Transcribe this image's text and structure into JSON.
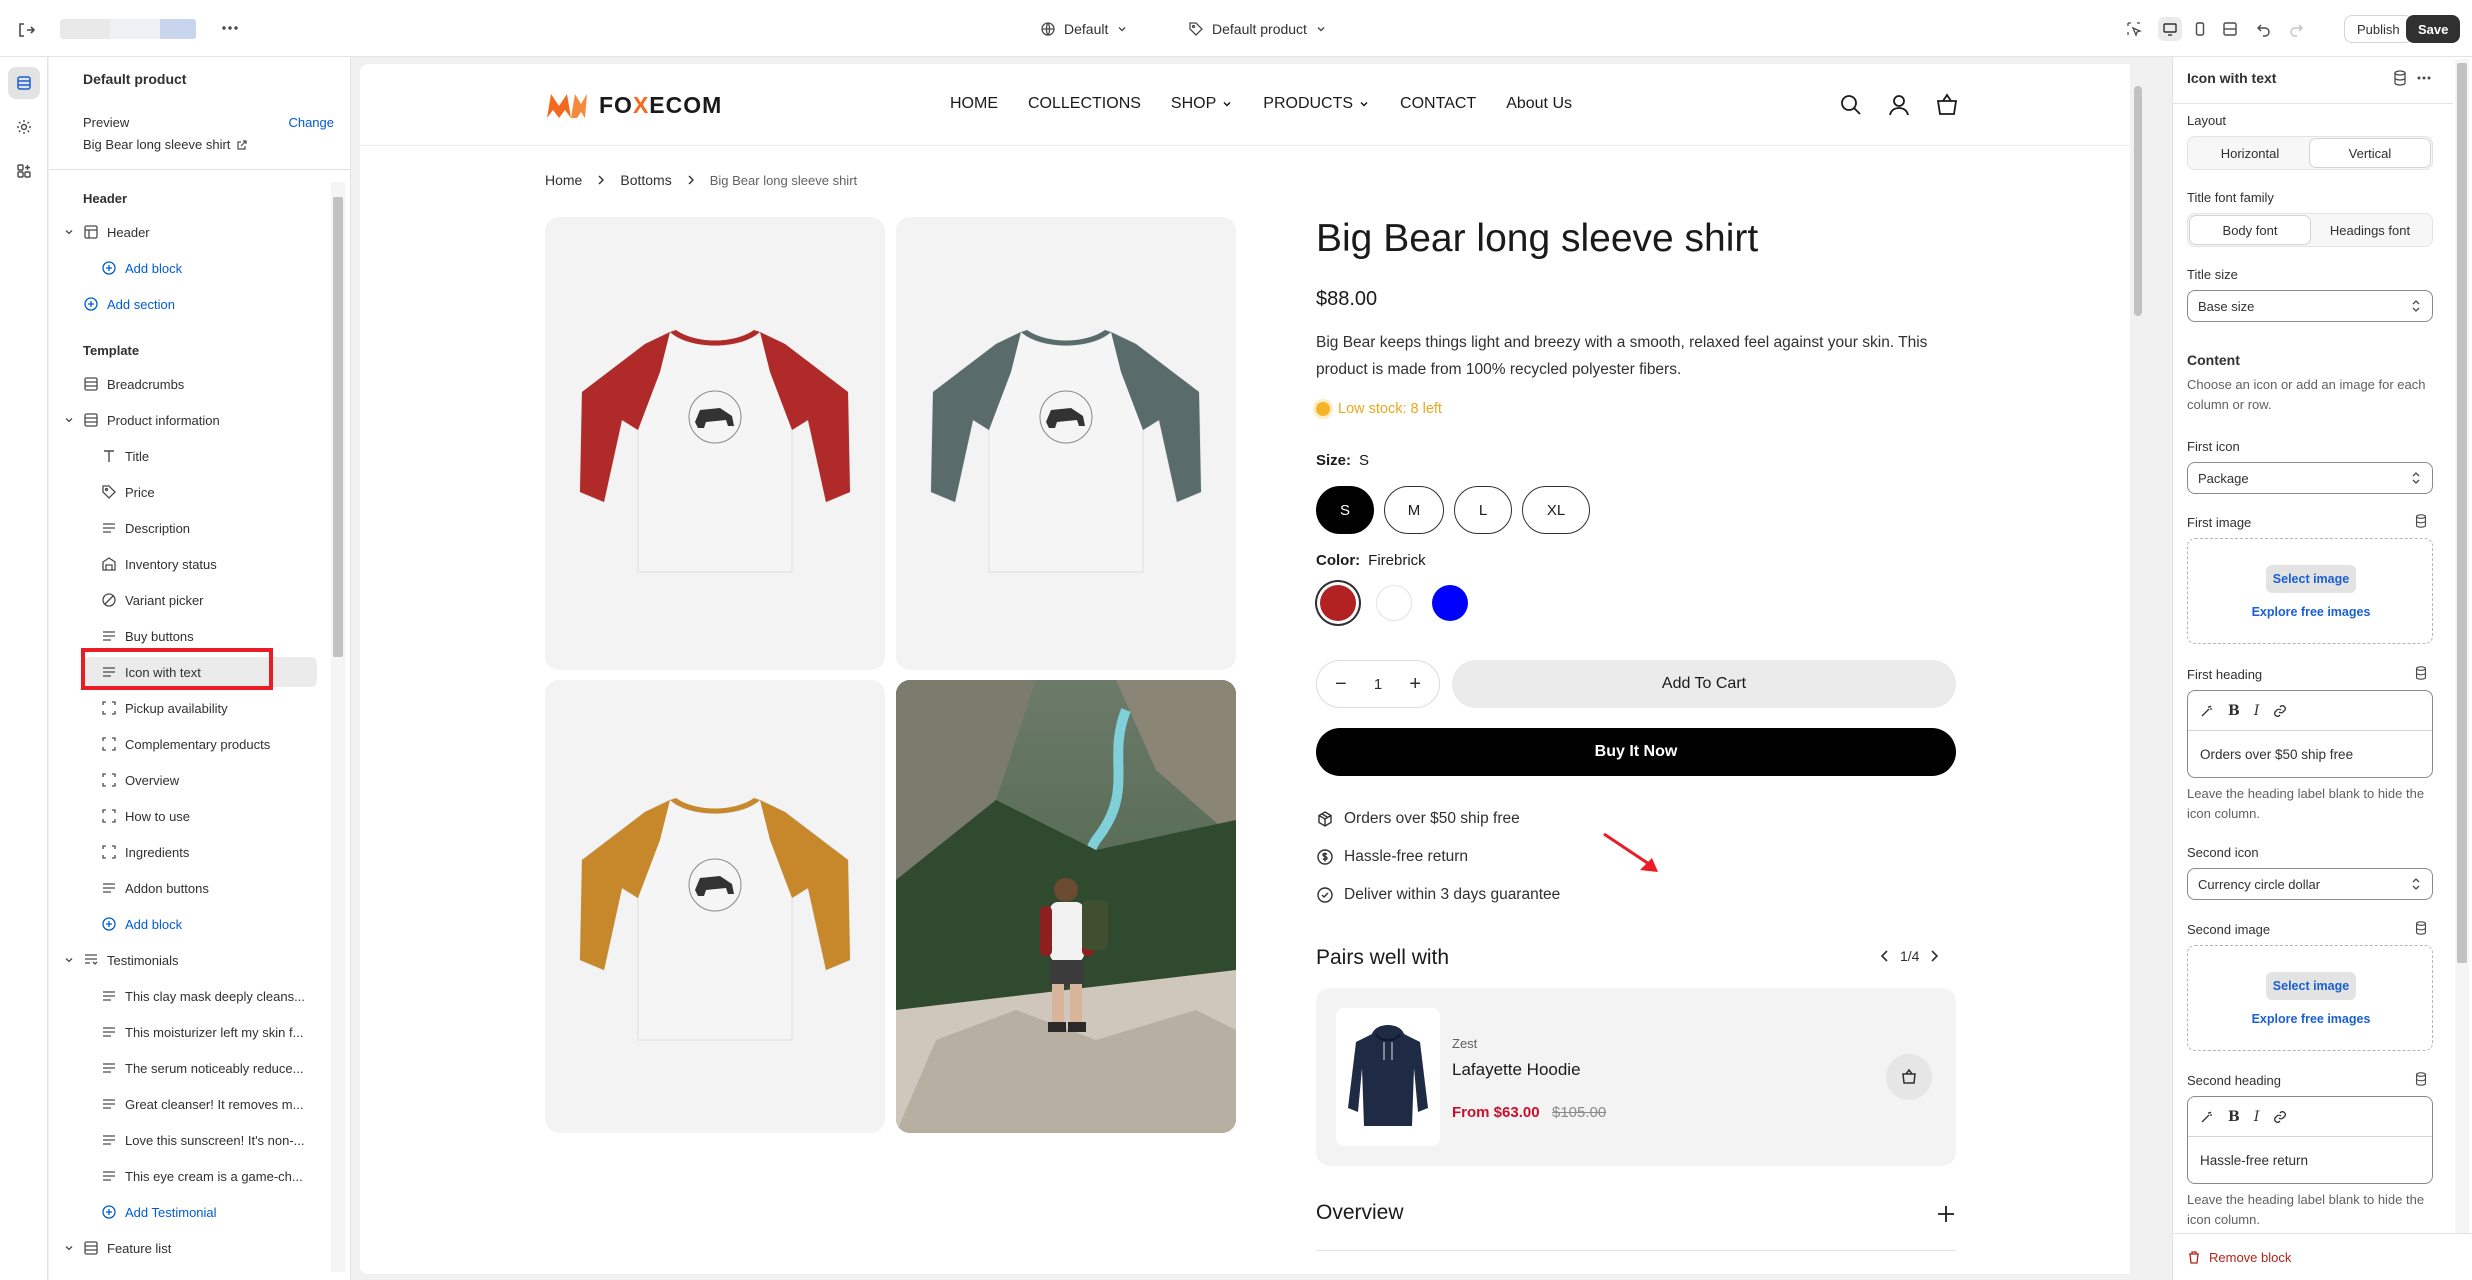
{
  "topbar": {
    "theme_label": "Default",
    "template_label": "Default product",
    "publish_label": "Publish",
    "save_label": "Save"
  },
  "left_panel": {
    "title": "Default product",
    "preview_label": "Preview",
    "change_label": "Change",
    "preview_value": "Big Bear long sleeve shirt",
    "header_section": "Header",
    "header_item": "Header",
    "add_block": "Add block",
    "add_section": "Add section",
    "template_section": "Template",
    "breadcrumbs": "Breadcrumbs",
    "product_information": "Product information",
    "blocks": [
      "Title",
      "Price",
      "Description",
      "Inventory status",
      "Variant picker",
      "Buy buttons",
      "Icon with text",
      "Pickup availability",
      "Complementary products",
      "Overview",
      "How to use",
      "Ingredients",
      "Addon buttons"
    ],
    "add_block_2": "Add block",
    "testimonials": "Testimonials",
    "testimonial_items": [
      "This clay mask deeply cleans...",
      "This moisturizer left my skin f...",
      "The serum noticeably reduce...",
      "Great cleanser! It removes m...",
      "Love this sunscreen! It's non-...",
      "This eye cream is a game-ch..."
    ],
    "add_testimonial": "Add Testimonial",
    "feature_list": "Feature list"
  },
  "store": {
    "logo": "FOXECOM",
    "nav": [
      "HOME",
      "COLLECTIONS",
      "SHOP",
      "PRODUCTS",
      "CONTACT",
      "About Us"
    ],
    "breadcrumb": [
      "Home",
      "Bottoms",
      "Big Bear long sleeve shirt"
    ],
    "tile_colors": [
      "#b02a2a",
      "#5a6b6b",
      "#c6882a"
    ],
    "product": {
      "title": "Big Bear long sleeve shirt",
      "price": "$88.00",
      "description": "Big Bear keeps things light and breezy with a smooth, relaxed feel against your skin. This product is made from 100% recycled polyester fibers.",
      "stock": "Low stock: 8 left",
      "size_label": "Size:",
      "size_value": "S",
      "sizes": [
        "S",
        "M",
        "L",
        "XL"
      ],
      "color_label": "Color:",
      "color_value": "Firebrick",
      "swatches": [
        "#b22222",
        "#ffffff",
        "#0000ff"
      ],
      "qty": "1",
      "add_to_cart": "Add To Cart",
      "buy_now": "Buy It Now"
    },
    "icon_with_text": [
      {
        "icon": "package-icon",
        "text": "Orders over $50 ship free"
      },
      {
        "icon": "currency-circle-dollar-icon",
        "text": "Hassle-free return"
      },
      {
        "icon": "check-circle-icon",
        "text": "Deliver within 3 days guarantee"
      }
    ],
    "pairs": {
      "title": "Pairs well with",
      "pager": "1/4",
      "vendor": "Zest",
      "name": "Lafayette Hoodie",
      "price": "From $63.00",
      "compare": "$105.00"
    },
    "overview": "Overview"
  },
  "right_panel": {
    "title": "Icon with text",
    "layout_label": "Layout",
    "layout_options": [
      "Horizontal",
      "Vertical"
    ],
    "title_font_label": "Title font family",
    "title_font_options": [
      "Body font",
      "Headings font"
    ],
    "title_size_label": "Title size",
    "title_size_value": "Base size",
    "content_label": "Content",
    "content_help": "Choose an icon or add an image for each column or row.",
    "first_icon_label": "First icon",
    "first_icon_value": "Package",
    "first_image_label": "First image",
    "select_image": "Select image",
    "explore_images": "Explore free images",
    "first_heading_label": "First heading",
    "first_heading_value": "Orders over $50 ship free",
    "heading_help": "Leave the heading label blank to hide the icon column.",
    "second_icon_label": "Second icon",
    "second_icon_value": "Currency circle dollar",
    "second_image_label": "Second image",
    "second_heading_label": "Second heading",
    "second_heading_value": "Hassle-free return",
    "remove_block": "Remove block"
  }
}
